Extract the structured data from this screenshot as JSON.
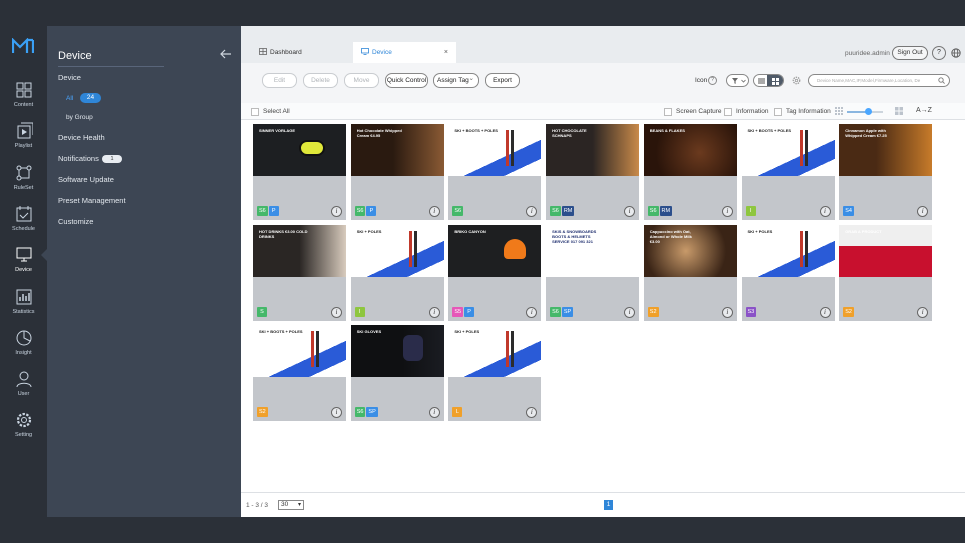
{
  "rail": {
    "items": [
      {
        "label": "Content",
        "icon": "content-icon"
      },
      {
        "label": "Playlist",
        "icon": "playlist-icon"
      },
      {
        "label": "RuleSet",
        "icon": "ruleset-icon"
      },
      {
        "label": "Schedule",
        "icon": "schedule-icon"
      },
      {
        "label": "Device",
        "icon": "device-icon"
      },
      {
        "label": "Statistics",
        "icon": "statistics-icon"
      },
      {
        "label": "Insight",
        "icon": "insight-icon"
      },
      {
        "label": "User",
        "icon": "user-icon"
      },
      {
        "label": "Setting",
        "icon": "setting-icon"
      }
    ],
    "active": "Device"
  },
  "panel": {
    "title": "Device",
    "menu": {
      "device": "Device",
      "all": "All",
      "all_count": "24",
      "by_group": "by Group",
      "device_health": "Device Health",
      "notifications": "Notifications",
      "notifications_count": "1",
      "software_update": "Software Update",
      "preset_management": "Preset Management",
      "customize": "Customize"
    }
  },
  "tabs": {
    "dashboard": "Dashboard",
    "device": "Device",
    "close": "×"
  },
  "header": {
    "user": "puuridee.admin",
    "sign_out": "Sign Out",
    "help": "?"
  },
  "toolbar": {
    "edit": "Edit",
    "delete": "Delete",
    "move": "Move",
    "quick_control": "Quick Control",
    "assign_tag": "Assign Tag",
    "assign_tag_caret": "⌄",
    "export": "Export",
    "icon_label": "Icon",
    "search_placeholder": "Device Name,MAC,IP,Model,Firmware,Location, De"
  },
  "options": {
    "select_all": "Select All",
    "screen_capture": "Screen Capture",
    "information": "Information",
    "tag_information": "Tag Information",
    "sort": "A→Z",
    "thumbnail_size": 0.6
  },
  "colors": {
    "accent": "#2f86d8",
    "badge_green": "#45b86a",
    "badge_blue": "#3a8ee6",
    "badge_navy": "#2c4f8c",
    "badge_orange": "#f0a02a",
    "badge_lime": "#8ec63f",
    "badge_pink": "#e657b8",
    "badge_purple": "#8a52c7",
    "badge_cyan": "#2bb2d1",
    "badge_teal": "#1fa9a0"
  },
  "cards": [
    {
      "thumb": "SINNER VORLAGE",
      "theme": "goggles",
      "badges": [
        {
          "t": "S6",
          "c": "#45b86a"
        },
        {
          "t": "P",
          "c": "#3a8ee6"
        }
      ]
    },
    {
      "thumb": "Hot Chocolate Whipped Cream €4.95",
      "theme": "choco",
      "badges": [
        {
          "t": "S6",
          "c": "#45b86a"
        },
        {
          "t": "P",
          "c": "#3a8ee6"
        }
      ]
    },
    {
      "thumb": "SKI + BOOTS + POLES",
      "theme": "ski",
      "badges": [
        {
          "t": "S6",
          "c": "#45b86a"
        }
      ]
    },
    {
      "thumb": "HOT CHOCOLATE SCHNAPS",
      "theme": "menu",
      "badges": [
        {
          "t": "S6",
          "c": "#45b86a"
        },
        {
          "t": "RM",
          "c": "#2c4f8c"
        }
      ]
    },
    {
      "thumb": "BEANS & FLAKES",
      "theme": "beans",
      "badges": [
        {
          "t": "S6",
          "c": "#45b86a"
        },
        {
          "t": "RM",
          "c": "#2c4f8c"
        }
      ]
    },
    {
      "thumb": "SKI + BOOTS + POLES",
      "theme": "ski",
      "badges": [
        {
          "t": "I",
          "c": "#8ec63f"
        }
      ]
    },
    {
      "thumb": "Cinnamon Apple with Whipped Cream €7.25",
      "theme": "apple",
      "badges": [
        {
          "t": "S4",
          "c": "#3a8ee6"
        }
      ]
    },
    {
      "thumb": "HOT DRINKS €3.00 COLD DRINKS",
      "theme": "drinks",
      "badges": [
        {
          "t": "S",
          "c": "#45b86a"
        }
      ]
    },
    {
      "thumb": "SKI + POLES",
      "theme": "ski",
      "badges": [
        {
          "t": "I",
          "c": "#8ec63f"
        }
      ]
    },
    {
      "thumb": "BRIKO CANYON",
      "theme": "helmet",
      "badges": [
        {
          "t": "S5",
          "c": "#e657b8"
        },
        {
          "t": "P",
          "c": "#3a8ee6"
        }
      ]
    },
    {
      "thumb": "SKIS & SNOWBOARDS BOOTS & HELMETS SERVICE 017 091 321",
      "theme": "list",
      "badges": [
        {
          "t": "S6",
          "c": "#45b86a"
        },
        {
          "t": "SP",
          "c": "#3a8ee6"
        }
      ]
    },
    {
      "thumb": "Cappuccino with Oat, Almond or Whole Milk €3.00",
      "theme": "cappuccino",
      "badges": [
        {
          "t": "S2",
          "c": "#f0a02a"
        }
      ]
    },
    {
      "thumb": "SKI + POLES",
      "theme": "ski",
      "badges": [
        {
          "t": "S3",
          "c": "#8a52c7"
        }
      ]
    },
    {
      "thumb": "GRAB A PRODUCT",
      "theme": "grab",
      "badges": [
        {
          "t": "S2",
          "c": "#f0a02a"
        }
      ]
    },
    {
      "thumb": "SKI + BOOTS + POLES",
      "theme": "ski",
      "badges": [
        {
          "t": "S2",
          "c": "#f0a02a"
        }
      ]
    },
    {
      "thumb": "SKI GLOVES",
      "theme": "gloves",
      "badges": [
        {
          "t": "S6",
          "c": "#45b86a"
        },
        {
          "t": "SP",
          "c": "#3a8ee6"
        }
      ]
    },
    {
      "thumb": "SKI + POLES",
      "theme": "ski",
      "badges": [
        {
          "t": "L",
          "c": "#f0a02a"
        }
      ]
    }
  ],
  "footer": {
    "range": "1 - 3 / 3",
    "page_size": "30",
    "page": "1"
  }
}
